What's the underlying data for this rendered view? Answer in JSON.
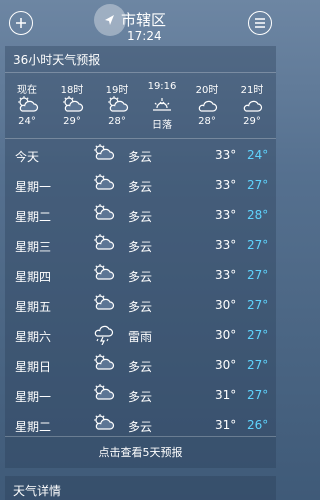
{
  "header": {
    "city": "市辖区",
    "time": "17:24"
  },
  "forecast36h": {
    "title": "36小时天气预报",
    "hours": [
      {
        "label": "现在",
        "icon": "partly-cloudy-icon",
        "temp": "24°"
      },
      {
        "label": "18时",
        "icon": "partly-cloudy-icon",
        "temp": "29°"
      },
      {
        "label": "19时",
        "icon": "partly-cloudy-icon",
        "temp": "28°"
      },
      {
        "label": "19:16",
        "icon": "sunset-icon",
        "temp": "日落"
      },
      {
        "label": "20时",
        "icon": "cloudy-night-icon",
        "temp": "28°"
      },
      {
        "label": "21时",
        "icon": "cloudy-night-icon",
        "temp": "29°"
      }
    ]
  },
  "daily": [
    {
      "day": "今天",
      "icon": "partly-cloudy-icon",
      "cond": "多云",
      "high": "33°",
      "low": "24°"
    },
    {
      "day": "星期一",
      "icon": "partly-cloudy-icon",
      "cond": "多云",
      "high": "33°",
      "low": "27°"
    },
    {
      "day": "星期二",
      "icon": "partly-cloudy-icon",
      "cond": "多云",
      "high": "33°",
      "low": "28°"
    },
    {
      "day": "星期三",
      "icon": "partly-cloudy-icon",
      "cond": "多云",
      "high": "33°",
      "low": "27°"
    },
    {
      "day": "星期四",
      "icon": "partly-cloudy-icon",
      "cond": "多云",
      "high": "33°",
      "low": "27°"
    },
    {
      "day": "星期五",
      "icon": "partly-cloudy-icon",
      "cond": "多云",
      "high": "30°",
      "low": "27°"
    },
    {
      "day": "星期六",
      "icon": "thunderstorm-icon",
      "cond": "雷雨",
      "high": "30°",
      "low": "27°"
    },
    {
      "day": "星期日",
      "icon": "partly-cloudy-icon",
      "cond": "多云",
      "high": "30°",
      "low": "27°"
    },
    {
      "day": "星期一",
      "icon": "partly-cloudy-icon",
      "cond": "多云",
      "high": "31°",
      "low": "27°"
    },
    {
      "day": "星期二",
      "icon": "partly-cloudy-icon",
      "cond": "多云",
      "high": "31°",
      "low": "26°"
    }
  ],
  "more_link": "点击查看5天预报",
  "details": {
    "title": "天气详情"
  },
  "colors": {
    "low_temp": "#5fd5ff",
    "panel": "#3c5a7e"
  }
}
